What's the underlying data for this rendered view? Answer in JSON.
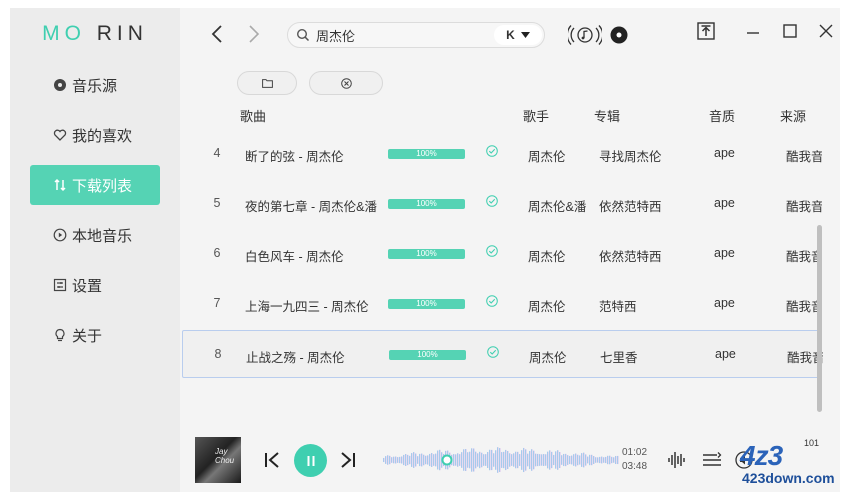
{
  "app": {
    "logo_a": "MO",
    "logo_b": "RIN"
  },
  "sidebar": {
    "items": [
      {
        "label": "音乐源",
        "icon": "disc-icon"
      },
      {
        "label": "我的喜欢",
        "icon": "heart-icon"
      },
      {
        "label": "下载列表",
        "icon": "sort-arrows-icon",
        "active": true
      },
      {
        "label": "本地音乐",
        "icon": "play-circle-icon"
      },
      {
        "label": "设置",
        "icon": "settings-icon"
      },
      {
        "label": "关于",
        "icon": "lightbulb-icon"
      }
    ]
  },
  "search": {
    "value": "周杰伦",
    "source_label": "K"
  },
  "table": {
    "headers": {
      "song": "歌曲",
      "singer": "歌手",
      "album": "专辑",
      "quality": "音质",
      "source": "来源"
    },
    "rows": [
      {
        "no": "4",
        "title": "断了的弦 - 周杰伦",
        "progress_text": "100%",
        "progress": 1.0,
        "singer": "周杰伦",
        "album": "寻找周杰伦",
        "quality": "ape",
        "source": "酷我音乐"
      },
      {
        "no": "5",
        "title": "夜的第七章 - 周杰伦&潘",
        "progress_text": "100%",
        "progress": 1.0,
        "singer": "周杰伦&潘",
        "album": "依然范特西",
        "quality": "ape",
        "source": "酷我音乐"
      },
      {
        "no": "6",
        "title": "白色风车 - 周杰伦",
        "progress_text": "100%",
        "progress": 1.0,
        "singer": "周杰伦",
        "album": "依然范特西",
        "quality": "ape",
        "source": "酷我音乐"
      },
      {
        "no": "7",
        "title": "上海一九四三 - 周杰伦",
        "progress_text": "100%",
        "progress": 1.0,
        "singer": "周杰伦",
        "album": "范特西",
        "quality": "ape",
        "source": "酷我音乐"
      },
      {
        "no": "8",
        "title": "止战之殇 - 周杰伦",
        "progress_text": "100%",
        "progress": 1.0,
        "singer": "周杰伦",
        "album": "七里香",
        "quality": "ape",
        "source": "酷我音乐",
        "selected": true
      }
    ]
  },
  "player": {
    "cover_text": "Jay Chou",
    "current_time": "01:02",
    "total_time": "03:48",
    "progress": 0.27,
    "volume": "101"
  },
  "watermark": {
    "big": "4z3",
    "small": "423down.com"
  },
  "colors": {
    "accent": "#55d3b4",
    "accent_dark": "#3fcfb0",
    "wave_left": "#7fd6e6",
    "wave_right": "#d9b2ea"
  }
}
